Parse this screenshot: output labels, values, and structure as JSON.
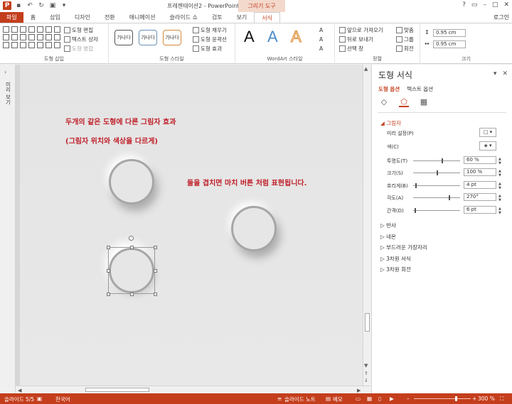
{
  "window": {
    "title": "프레젠테이션2 - PowerPoint",
    "context_tool": "그리기 도구",
    "controls": [
      "?",
      "▭",
      "–",
      "□",
      "✕"
    ]
  },
  "tabs": [
    {
      "label": "파일"
    },
    {
      "label": "홈"
    },
    {
      "label": "삽입"
    },
    {
      "label": "디자인"
    },
    {
      "label": "전환"
    },
    {
      "label": "애니메이션"
    },
    {
      "label": "슬라이드 쇼"
    },
    {
      "label": "검토"
    },
    {
      "label": "보기"
    },
    {
      "label": "서식"
    }
  ],
  "signin": "로그인",
  "ribbon": {
    "insert_shapes": {
      "label": "도형 삽입",
      "edit_shape": "도형 편집",
      "text_box": "텍스트 상자",
      "merge_shapes": "도형 병합"
    },
    "shape_styles": {
      "label": "도형 스타일",
      "sample_text": "가나다",
      "fill": "도형 채우기",
      "outline": "도형 윤곽선",
      "effects": "도형 효과"
    },
    "wordart": {
      "label": "WordArt 스타일",
      "letter": "A"
    },
    "arrange": {
      "label": "정렬",
      "bring_forward": "앞으로 가져오기",
      "send_backward": "뒤로 보내기",
      "selection_pane": "선택 창",
      "align": "맞춤",
      "group": "그룹",
      "rotate": "회전"
    },
    "size": {
      "label": "크기",
      "height": "0.95 cm",
      "width": "0.95 cm"
    }
  },
  "left_rail": {
    "label": "미리 보기"
  },
  "slide": {
    "line1": "두개의 같은 도형에 다른 그림자 효과",
    "line2": "(그림자 위치와 색상을 다르게)",
    "line3": "둘을 겹치면 마치 버튼 처럼 표현됩니다."
  },
  "pane": {
    "title": "도형 서식",
    "tab_shape": "도형 옵션",
    "tab_text": "텍스트 옵션",
    "shadow": {
      "header": "그림자",
      "preset": "미리 설정(P)",
      "color": "색(C)",
      "transparency": {
        "label": "투명도(T)",
        "value": "60 %",
        "level": 0.6
      },
      "size": {
        "label": "크기(S)",
        "value": "100 %",
        "level": 0.5
      },
      "blur": {
        "label": "흐리게(B)",
        "value": "4 pt",
        "level": 0.04
      },
      "angle": {
        "label": "각도(A)",
        "value": "270°",
        "level": 0.75
      },
      "distance": {
        "label": "간격(D)",
        "value": "6 pt",
        "level": 0.03
      }
    },
    "sections": [
      "반사",
      "네온",
      "부드러운 가장자리",
      "3차원 서식",
      "3차원 회전"
    ]
  },
  "status": {
    "slide_count": "슬라이드 5/5",
    "language": "한국어",
    "notes": "슬라이드 노트",
    "comments": "메모",
    "zoom": "300 %",
    "zoom_level": 0.73
  },
  "colors": {
    "accent": "#c43e1c",
    "slide_text": "#c0202a"
  }
}
